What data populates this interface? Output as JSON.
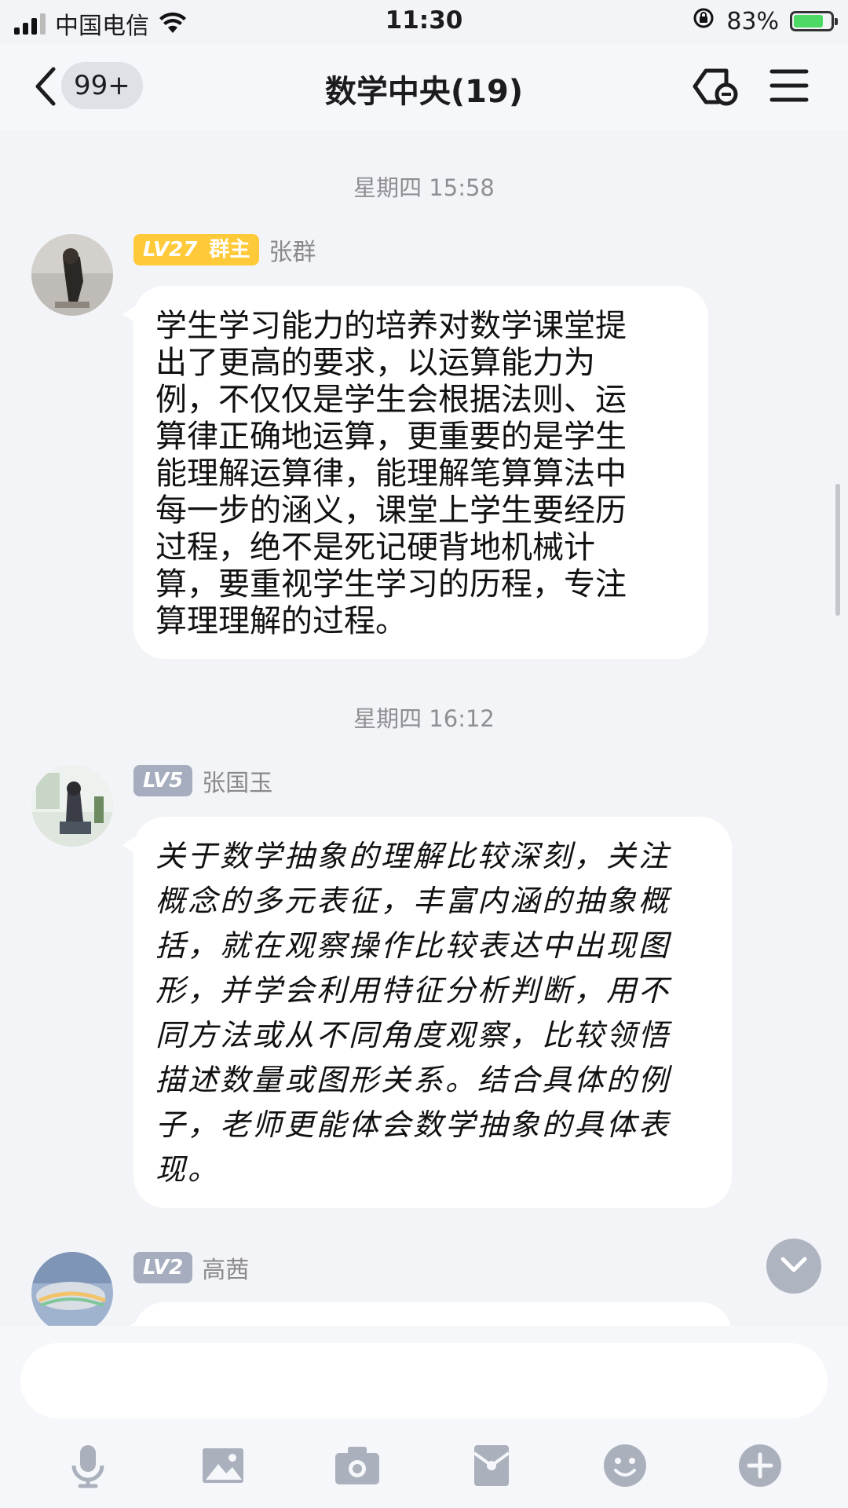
{
  "status_bar": {
    "carrier": "中国电信",
    "time": "11:30",
    "battery_percent": "83%",
    "battery_level": 0.83
  },
  "header": {
    "back_badge": "99+",
    "title": "数学中央(19)"
  },
  "messages": [
    {
      "timestamp": "星期四 15:58",
      "level": "LV27",
      "role": "群主",
      "sender": "张群",
      "lines": [
        "学生学习能力的培养对数学课堂提",
        "出了更高的要求，以运算能力为",
        "例，不仅仅是学生会根据法则、运",
        "算律正确地运算，更重要的是学生",
        "能理解运算律，能理解笔算算法中",
        "每一步的涵义，课堂上学生要经历",
        "过程，绝不是死记硬背地机械计",
        "算，要重视学生学习的历程，专注",
        "算理理解的过程。"
      ]
    },
    {
      "timestamp": "星期四 16:12",
      "level": "LV5",
      "sender": "张国玉",
      "lines": [
        "关于数学抽象的理解比较深刻，关注",
        "概念的多元表征，丰富内涵的抽象概",
        "括，就在观察操作比较表达中出现图",
        "形，并学会利用特征分析判断，用不",
        "同方法或从不同角度观察，比较领悟",
        "描述数量或图形关系。结合具体的例",
        "子，老师更能体会数学抽象的具体表",
        "现。"
      ]
    },
    {
      "level": "LV2",
      "sender": "高茜"
    }
  ],
  "input": {
    "placeholder": ""
  },
  "toolbar_icons": [
    "microphone-icon",
    "image-icon",
    "camera-icon",
    "red-packet-icon",
    "emoji-icon",
    "plus-icon"
  ],
  "colors": {
    "background": "#f3f4f8",
    "owner_badge": "#ffca3a",
    "level_badge": "#a6adbe",
    "battery": "#4cd964"
  }
}
